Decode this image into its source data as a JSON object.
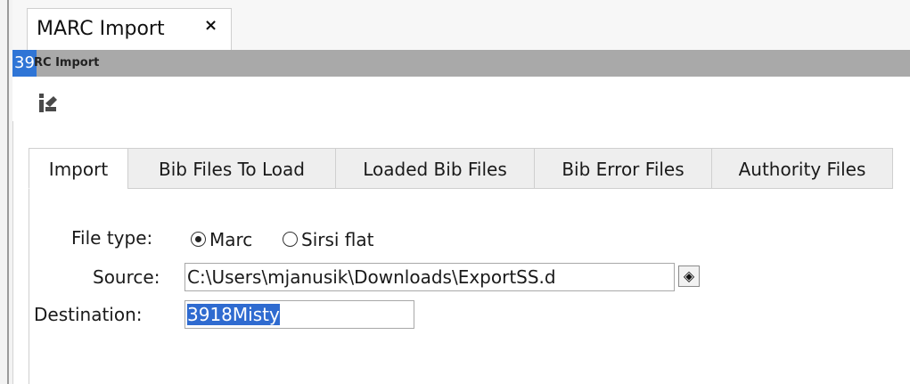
{
  "window_tab": {
    "title": "MARC Import",
    "close_glyph": "×"
  },
  "titlebar": {
    "number": "39",
    "label": "RC Import"
  },
  "toolbar": {
    "icon": "import-tool-icon"
  },
  "tabs": [
    {
      "label": "Import",
      "active": true
    },
    {
      "label": "Bib Files To Load",
      "active": false
    },
    {
      "label": "Loaded Bib Files",
      "active": false
    },
    {
      "label": "Bib Error Files",
      "active": false
    },
    {
      "label": "Authority Files",
      "active": false
    }
  ],
  "form": {
    "file_type_label": "File type:",
    "file_type_options": [
      {
        "label": "Marc",
        "selected": true
      },
      {
        "label": "Sirsi flat",
        "selected": false
      }
    ],
    "source_label": "Source:",
    "source_value": "C:\\Users\\mjanusik\\Downloads\\ExportSS.d",
    "browse_glyph": "◈",
    "destination_label": "Destination:",
    "destination_value": "3918Misty"
  },
  "colors": {
    "titlebar": "#a9a9a9",
    "selection": "#2f6bd0"
  }
}
